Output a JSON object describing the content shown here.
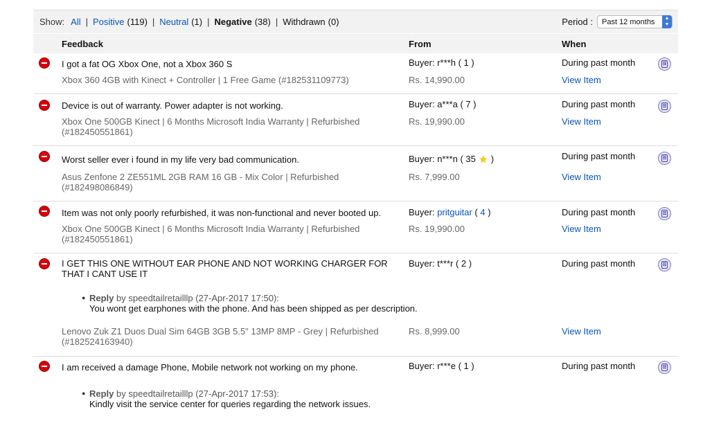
{
  "filters": {
    "show_label": "Show:",
    "all": "All",
    "positive_label": "Positive",
    "positive_count": "(119)",
    "neutral_label": "Neutral",
    "neutral_count": "(1)",
    "negative_label": "Negative",
    "negative_count": "(38)",
    "withdrawn_label": "Withdrawn",
    "withdrawn_count": "(0)",
    "period_label": "Period :",
    "period_value": "Past 12 months"
  },
  "columns": {
    "feedback": "Feedback",
    "from": "From",
    "when": "When"
  },
  "rows": [
    {
      "comment": "I got a fat OG Xbox One, not a Xbox 360 S",
      "item": "Xbox 360 4GB with Kinect + Controller | 1 Free Game (#182531109773)",
      "buyer_prefix": "Buyer:",
      "buyer": "r***h",
      "score_open": "( ",
      "score": "1",
      "score_close": " )",
      "price": "Rs. 14,990.00",
      "when": "During past month",
      "view_item": "View Item"
    },
    {
      "comment": "Device is out of warranty. Power adapter is not working.",
      "item": "Xbox One 500GB Kinect | 6 Months Microsoft India Warranty | Refurbished (#182450551861)",
      "buyer_prefix": "Buyer:",
      "buyer": "a***a",
      "score_open": "( ",
      "score": "7",
      "score_close": " )",
      "price": "Rs. 19,990.00",
      "when": "During past month",
      "view_item": "View Item"
    },
    {
      "comment": "Worst seller ever i found in my life very bad communication.",
      "item": "Asus Zenfone 2 ZE551ML 2GB RAM 16 GB - Mix Color | Refurbished (#182498086849)",
      "buyer_prefix": "Buyer:",
      "buyer": "n***n",
      "score_open": "( ",
      "score": "35",
      "score_close": " )",
      "price": "Rs. 7,999.00",
      "when": "During past month",
      "view_item": "View Item"
    },
    {
      "comment": "Item was not only poorly refurbished, it was non-functional and never booted up.",
      "item": "Xbox One 500GB Kinect | 6 Months Microsoft India Warranty | Refurbished (#182450551861)",
      "buyer_prefix": "Buyer:",
      "buyer": "pritguitar",
      "score_open": "( ",
      "score": "4",
      "score_close": " )",
      "price": "Rs. 19,990.00",
      "when": "During past month",
      "view_item": "View Item"
    },
    {
      "comment": "I GET THIS ONE WITHOUT EAR PHONE AND NOT WORKING CHARGER FOR THAT I CANT USE IT",
      "reply_label": "Reply",
      "reply_meta": "by speedtailretailllp (27-Apr-2017 17:50):",
      "reply_text": "You wont get earphones with the phone. And has been shipped as per description.",
      "item": "Lenovo Zuk Z1 Duos Dual Sim 64GB 3GB 5.5\" 13MP 8MP - Grey | Refurbished (#182524163940)",
      "buyer_prefix": "Buyer:",
      "buyer": "t***r",
      "score_open": "( ",
      "score": "2",
      "score_close": " )",
      "price": "Rs. 8,999.00",
      "when": "During past month",
      "view_item": "View Item"
    },
    {
      "comment": "I am received a damage Phone, Mobile network not working on my phone.",
      "reply_label": "Reply",
      "reply_meta": "by speedtailretailllp (27-Apr-2017 17:53):",
      "reply_text": "Kindly visit the service center for queries regarding the network issues.",
      "buyer_prefix": "Buyer:",
      "buyer": "r***e",
      "score_open": "( ",
      "score": "1",
      "score_close": " )",
      "when": "During past month"
    }
  ]
}
